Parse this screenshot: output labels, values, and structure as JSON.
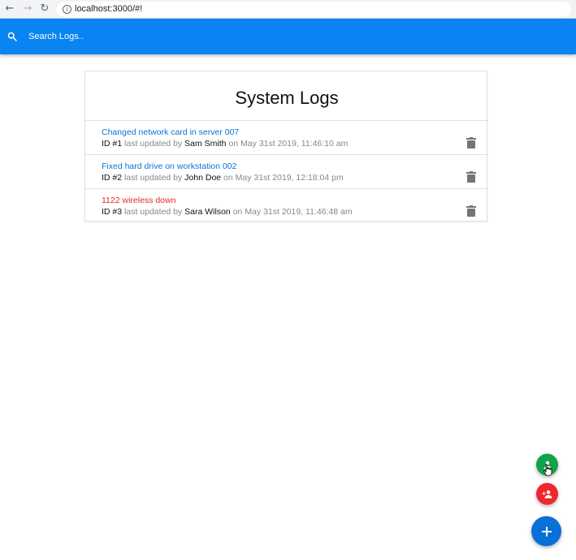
{
  "browser": {
    "back_icon": "←",
    "forward_icon": "→",
    "reload_icon": "↻",
    "info_icon": "i",
    "url": "localhost:3000/#!"
  },
  "search": {
    "placeholder": "Search Logs.."
  },
  "card": {
    "title": "System Logs"
  },
  "logs": [
    {
      "message": "Changed network card in server 007",
      "id_label": "ID #1",
      "updated_text": "last updated by",
      "tech": "Sam Smith",
      "on_text": "on",
      "date": "May 31st 2019, 11:46:10 am",
      "attention": false
    },
    {
      "message": "Fixed hard drive on workstation 002",
      "id_label": "ID #2",
      "updated_text": "last updated by",
      "tech": "John Doe",
      "on_text": "on",
      "date": "May 31st 2019, 12:18:04 pm",
      "attention": false
    },
    {
      "message": "1122 wireless down",
      "id_label": "ID #3",
      "updated_text": "last updated by",
      "tech": "Sara Wilson",
      "on_text": "on",
      "date": "May 31st 2019, 11:46:48 am",
      "attention": true
    }
  ],
  "colors": {
    "search_bar": "#0a84f2",
    "link": "#0a73d9",
    "attention": "#ea2626",
    "fab_green": "#12a24a",
    "fab_red": "#f0262f",
    "fab_blue": "#0a6fd6"
  },
  "icons": {
    "search": "search-icon",
    "delete": "trash-icon",
    "user": "person-icon",
    "add_user": "person-add-icon",
    "add": "plus-icon"
  }
}
